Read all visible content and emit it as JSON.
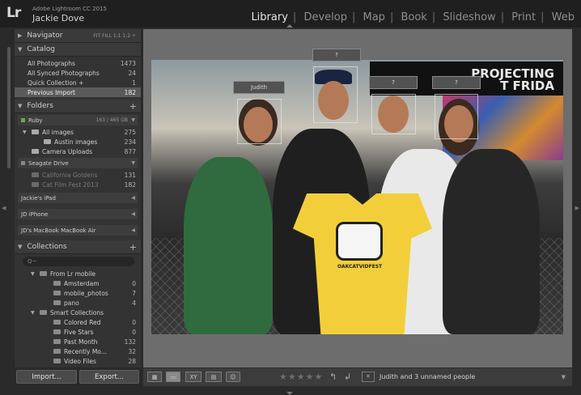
{
  "app": {
    "logo": "Lr",
    "product": "Adobe Lightroom CC 2015",
    "user": "Jackie Dove"
  },
  "modules": [
    {
      "label": "Library",
      "active": true
    },
    {
      "label": "Develop",
      "active": false
    },
    {
      "label": "Map",
      "active": false
    },
    {
      "label": "Book",
      "active": false
    },
    {
      "label": "Slideshow",
      "active": false
    },
    {
      "label": "Print",
      "active": false
    },
    {
      "label": "Web",
      "active": false
    }
  ],
  "navigator": {
    "title": "Navigator",
    "zoom_options": "FIT  FILL  1:1  1:2 ÷"
  },
  "catalog": {
    "title": "Catalog",
    "items": [
      {
        "label": "All Photographs",
        "count": "1473"
      },
      {
        "label": "All Synced Photographs",
        "count": "24"
      },
      {
        "label": "Quick Collection +",
        "count": "1"
      },
      {
        "label": "Previous Import",
        "count": "182"
      }
    ]
  },
  "folders": {
    "title": "Folders",
    "drive_ruby": {
      "label": "Ruby",
      "count": "163 / 465 GB"
    },
    "items": [
      {
        "label": "All images",
        "count": "275"
      },
      {
        "label": "Austin images",
        "count": "234"
      },
      {
        "label": "Camera Uploads",
        "count": "877"
      }
    ],
    "drive_seagate": {
      "label": "Seagate Drive"
    },
    "seagate_items": [
      {
        "label": "California Goldens",
        "count": "131"
      },
      {
        "label": "Cat Film Fest 2013",
        "count": "182"
      }
    ],
    "devices": [
      "Jackie's iPad",
      "JD iPhone",
      "JD's MacBook MacBook Air"
    ]
  },
  "collections": {
    "title": "Collections",
    "search_placeholder": "Q~",
    "groups": [
      {
        "label": "From Lr mobile",
        "items": [
          {
            "label": "Amsterdam",
            "count": "0"
          },
          {
            "label": "mobile_photos",
            "count": "7"
          },
          {
            "label": "pano",
            "count": "4"
          }
        ]
      },
      {
        "label": "Smart Collections",
        "items": [
          {
            "label": "Colored Red",
            "count": "0"
          },
          {
            "label": "Five Stars",
            "count": "0"
          },
          {
            "label": "Past Month",
            "count": "132"
          },
          {
            "label": "Recently Mo...",
            "count": "32"
          },
          {
            "label": "Video Files",
            "count": "28"
          }
        ]
      }
    ]
  },
  "buttons": {
    "import": "Import...",
    "export": "Export..."
  },
  "photo": {
    "banner": "PROJECTING\nT FRIDA",
    "shirt_text": "OAKCATVIDFEST",
    "face_labels": [
      "Judith",
      "?",
      "?",
      "?"
    ]
  },
  "toolbar": {
    "people_info": "Judith and 3 unnamed people",
    "stars": "★★★★★"
  }
}
